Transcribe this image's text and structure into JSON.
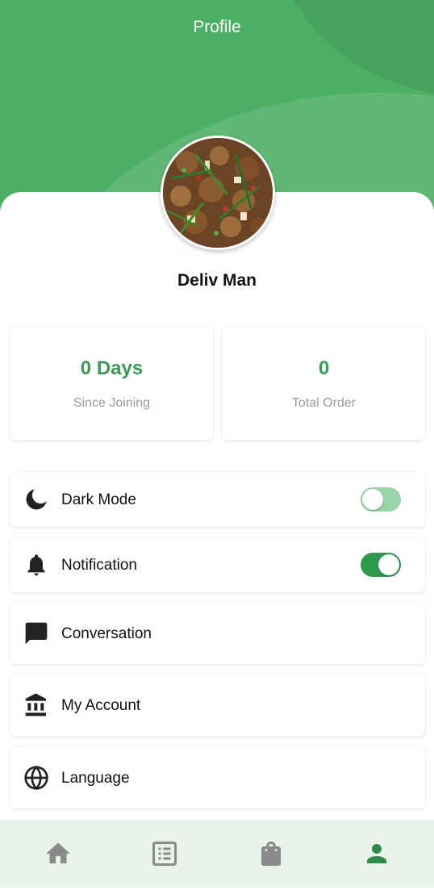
{
  "header": {
    "title": "Profile"
  },
  "profile": {
    "name": "Deliv Man"
  },
  "stats": [
    {
      "value": "0 Days",
      "label": "Since Joining"
    },
    {
      "value": "0",
      "label": "Total Order"
    }
  ],
  "menu": {
    "dark_mode": {
      "label": "Dark Mode",
      "icon": "moon-icon",
      "enabled": false
    },
    "notification": {
      "label": "Notification",
      "icon": "bell-icon",
      "enabled": true
    },
    "conversation": {
      "label": "Conversation",
      "icon": "chat-icon"
    },
    "my_account": {
      "label": "My Account",
      "icon": "bank-icon"
    },
    "language": {
      "label": "Language",
      "icon": "globe-icon"
    }
  },
  "bottom_nav": [
    {
      "icon": "home-icon",
      "active": false
    },
    {
      "icon": "list-icon",
      "active": false
    },
    {
      "icon": "shopping-bag-icon",
      "active": false
    },
    {
      "icon": "person-icon",
      "active": true
    }
  ],
  "colors": {
    "header_green": "#4caf63",
    "accent_green": "#3a9a52",
    "toggle_on": "#2e9a4e",
    "toggle_off": "#99d4a8",
    "nav_background": "#e8f3ea",
    "nav_icon_inactive": "#8a8a8a",
    "nav_icon_active": "#2e8b4a"
  }
}
